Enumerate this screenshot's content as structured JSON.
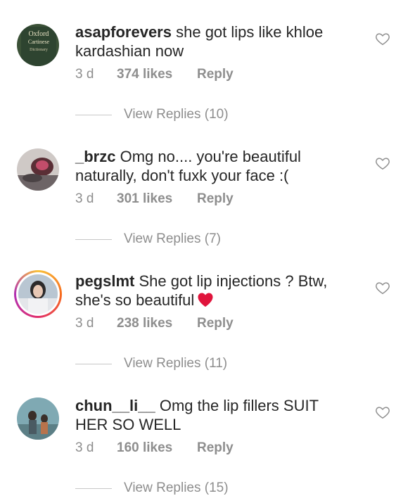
{
  "comments": [
    {
      "username": "asapforevers",
      "text": "she got lips like khloe kardashian now",
      "time": "3 d",
      "likes": "374 likes",
      "reply": "Reply",
      "view_replies": "View Replies (10)",
      "avatar_text": [
        "Oxford",
        "Cartinese",
        "Dictionary"
      ]
    },
    {
      "username": "_brzc",
      "text": "Omg no.... you're beautiful naturally, don't fuxk your face :(",
      "time": "3 d",
      "likes": "301 likes",
      "reply": "Reply",
      "view_replies": "View Replies (7)"
    },
    {
      "username": "pegslmt",
      "text": "She got lip injections ? Btw, she's so beautiful",
      "time": "3 d",
      "likes": "238 likes",
      "reply": "Reply",
      "view_replies": "View Replies (11)"
    },
    {
      "username": "chun__li__",
      "text": "Omg the lip fillers SUIT HER SO WELL",
      "time": "3 d",
      "likes": "160 likes",
      "reply": "Reply",
      "view_replies": "View Replies (15)"
    }
  ],
  "icons": {
    "like": "heart-outline-icon",
    "emoji": "red-heart-emoji"
  },
  "colors": {
    "meta": "#8e8e8e",
    "text": "#262626",
    "emoji_heart": "#e0143c"
  }
}
